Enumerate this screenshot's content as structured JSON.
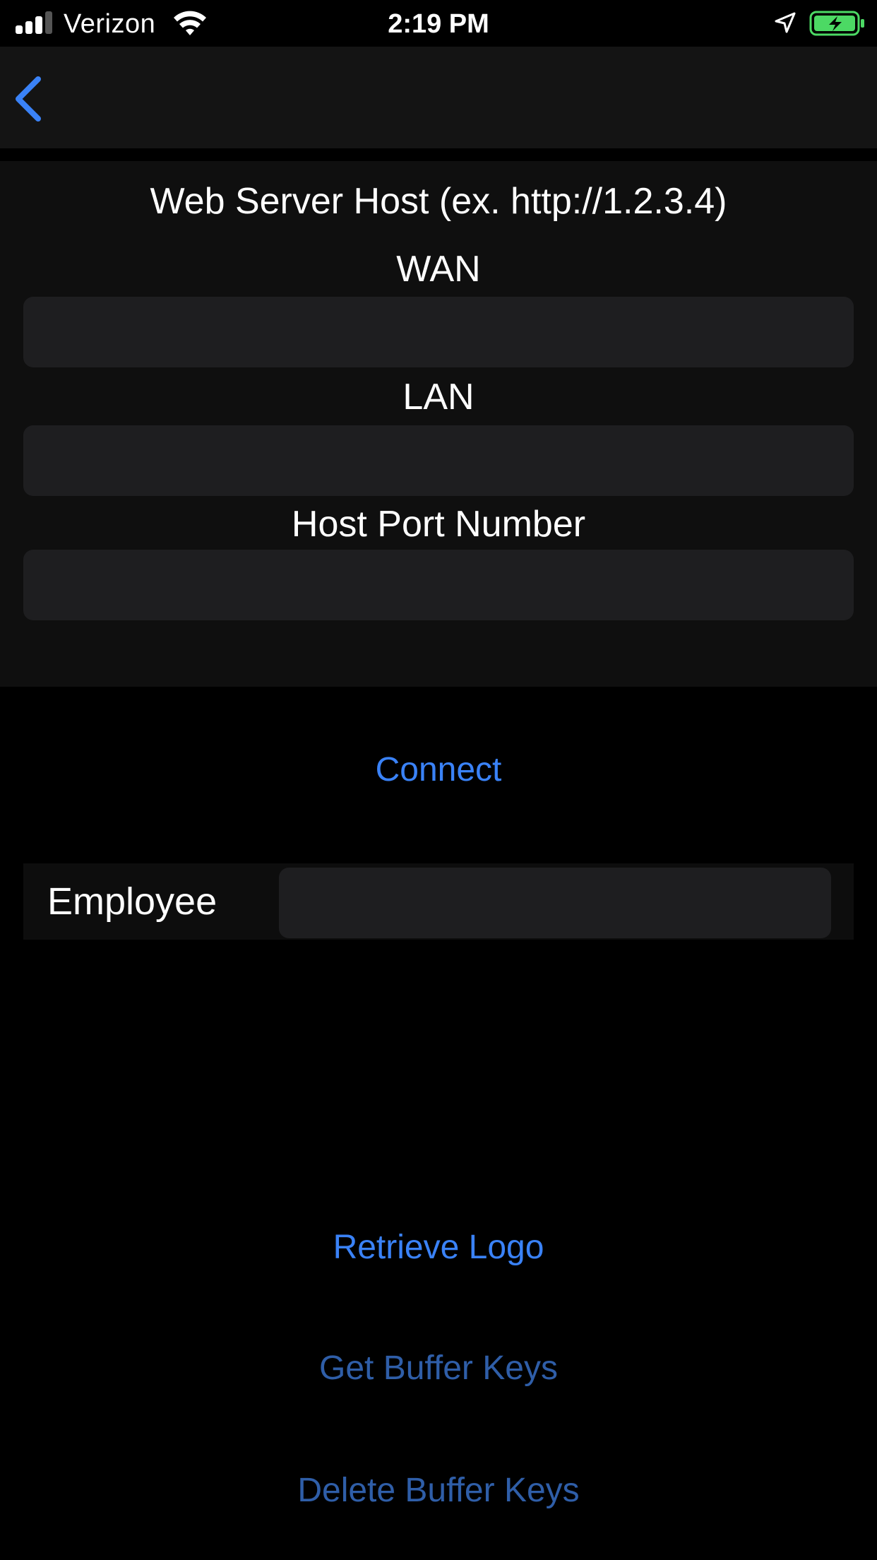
{
  "status_bar": {
    "carrier": "Verizon",
    "time": "2:19 PM",
    "signal_icon": "cellular-signal-icon",
    "wifi_icon": "wifi-icon",
    "location_icon": "location-arrow-icon",
    "battery_icon": "battery-charging-icon",
    "battery_color": "#4cd964"
  },
  "nav": {
    "back_icon": "chevron-left-icon"
  },
  "host_section": {
    "title": "Web Server Host (ex. http://1.2.3.4)",
    "wan_label": "WAN",
    "wan_value": "",
    "lan_label": "LAN",
    "lan_value": "",
    "port_label": "Host Port Number",
    "port_value": ""
  },
  "actions": {
    "connect": "Connect",
    "retrieve_logo": "Retrieve Logo",
    "get_buffer_keys": "Get Buffer Keys",
    "delete_buffer_keys": "Delete Buffer Keys"
  },
  "employee": {
    "label": "Employee",
    "value": ""
  },
  "colors": {
    "accent": "#3a82f7",
    "accent_dim": "#2f5ea8",
    "background": "#000000",
    "field": "#1e1e20"
  }
}
